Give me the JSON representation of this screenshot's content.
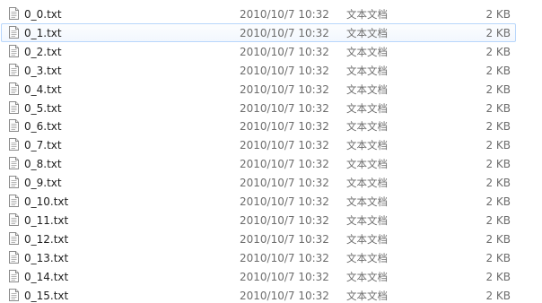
{
  "files": [
    {
      "name": "0_0.txt",
      "date": "2010/10/7 10:32",
      "type": "文本文档",
      "size": "2 KB"
    },
    {
      "name": "0_1.txt",
      "date": "2010/10/7 10:32",
      "type": "文本文档",
      "size": "2 KB"
    },
    {
      "name": "0_2.txt",
      "date": "2010/10/7 10:32",
      "type": "文本文档",
      "size": "2 KB"
    },
    {
      "name": "0_3.txt",
      "date": "2010/10/7 10:32",
      "type": "文本文档",
      "size": "2 KB"
    },
    {
      "name": "0_4.txt",
      "date": "2010/10/7 10:32",
      "type": "文本文档",
      "size": "2 KB"
    },
    {
      "name": "0_5.txt",
      "date": "2010/10/7 10:32",
      "type": "文本文档",
      "size": "2 KB"
    },
    {
      "name": "0_6.txt",
      "date": "2010/10/7 10:32",
      "type": "文本文档",
      "size": "2 KB"
    },
    {
      "name": "0_7.txt",
      "date": "2010/10/7 10:32",
      "type": "文本文档",
      "size": "2 KB"
    },
    {
      "name": "0_8.txt",
      "date": "2010/10/7 10:32",
      "type": "文本文档",
      "size": "2 KB"
    },
    {
      "name": "0_9.txt",
      "date": "2010/10/7 10:32",
      "type": "文本文档",
      "size": "2 KB"
    },
    {
      "name": "0_10.txt",
      "date": "2010/10/7 10:32",
      "type": "文本文档",
      "size": "2 KB"
    },
    {
      "name": "0_11.txt",
      "date": "2010/10/7 10:32",
      "type": "文本文档",
      "size": "2 KB"
    },
    {
      "name": "0_12.txt",
      "date": "2010/10/7 10:32",
      "type": "文本文档",
      "size": "2 KB"
    },
    {
      "name": "0_13.txt",
      "date": "2010/10/7 10:32",
      "type": "文本文档",
      "size": "2 KB"
    },
    {
      "name": "0_14.txt",
      "date": "2010/10/7 10:32",
      "type": "文本文档",
      "size": "2 KB"
    },
    {
      "name": "0_15.txt",
      "date": "2010/10/7 10:32",
      "type": "文本文档",
      "size": "2 KB"
    }
  ],
  "hovered_index": 1,
  "file_icon": "text-document-icon",
  "colors": {
    "hover_border": "#b8d6fb",
    "hover_background": "#f2f7fe"
  }
}
